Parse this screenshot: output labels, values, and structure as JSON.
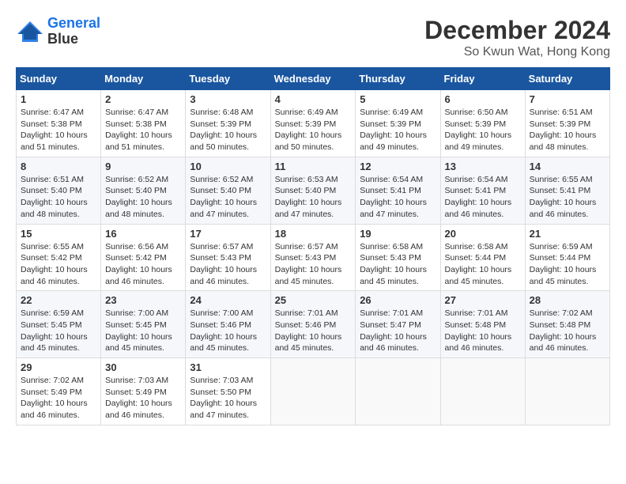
{
  "header": {
    "logo_line1": "General",
    "logo_line2": "Blue",
    "month": "December 2024",
    "location": "So Kwun Wat, Hong Kong"
  },
  "weekdays": [
    "Sunday",
    "Monday",
    "Tuesday",
    "Wednesday",
    "Thursday",
    "Friday",
    "Saturday"
  ],
  "weeks": [
    [
      {
        "day": "1",
        "sunrise": "6:47 AM",
        "sunset": "5:38 PM",
        "daylight": "10 hours and 51 minutes."
      },
      {
        "day": "2",
        "sunrise": "6:47 AM",
        "sunset": "5:38 PM",
        "daylight": "10 hours and 51 minutes."
      },
      {
        "day": "3",
        "sunrise": "6:48 AM",
        "sunset": "5:39 PM",
        "daylight": "10 hours and 50 minutes."
      },
      {
        "day": "4",
        "sunrise": "6:49 AM",
        "sunset": "5:39 PM",
        "daylight": "10 hours and 50 minutes."
      },
      {
        "day": "5",
        "sunrise": "6:49 AM",
        "sunset": "5:39 PM",
        "daylight": "10 hours and 49 minutes."
      },
      {
        "day": "6",
        "sunrise": "6:50 AM",
        "sunset": "5:39 PM",
        "daylight": "10 hours and 49 minutes."
      },
      {
        "day": "7",
        "sunrise": "6:51 AM",
        "sunset": "5:39 PM",
        "daylight": "10 hours and 48 minutes."
      }
    ],
    [
      {
        "day": "8",
        "sunrise": "6:51 AM",
        "sunset": "5:40 PM",
        "daylight": "10 hours and 48 minutes."
      },
      {
        "day": "9",
        "sunrise": "6:52 AM",
        "sunset": "5:40 PM",
        "daylight": "10 hours and 48 minutes."
      },
      {
        "day": "10",
        "sunrise": "6:52 AM",
        "sunset": "5:40 PM",
        "daylight": "10 hours and 47 minutes."
      },
      {
        "day": "11",
        "sunrise": "6:53 AM",
        "sunset": "5:40 PM",
        "daylight": "10 hours and 47 minutes."
      },
      {
        "day": "12",
        "sunrise": "6:54 AM",
        "sunset": "5:41 PM",
        "daylight": "10 hours and 47 minutes."
      },
      {
        "day": "13",
        "sunrise": "6:54 AM",
        "sunset": "5:41 PM",
        "daylight": "10 hours and 46 minutes."
      },
      {
        "day": "14",
        "sunrise": "6:55 AM",
        "sunset": "5:41 PM",
        "daylight": "10 hours and 46 minutes."
      }
    ],
    [
      {
        "day": "15",
        "sunrise": "6:55 AM",
        "sunset": "5:42 PM",
        "daylight": "10 hours and 46 minutes."
      },
      {
        "day": "16",
        "sunrise": "6:56 AM",
        "sunset": "5:42 PM",
        "daylight": "10 hours and 46 minutes."
      },
      {
        "day": "17",
        "sunrise": "6:57 AM",
        "sunset": "5:43 PM",
        "daylight": "10 hours and 46 minutes."
      },
      {
        "day": "18",
        "sunrise": "6:57 AM",
        "sunset": "5:43 PM",
        "daylight": "10 hours and 45 minutes."
      },
      {
        "day": "19",
        "sunrise": "6:58 AM",
        "sunset": "5:43 PM",
        "daylight": "10 hours and 45 minutes."
      },
      {
        "day": "20",
        "sunrise": "6:58 AM",
        "sunset": "5:44 PM",
        "daylight": "10 hours and 45 minutes."
      },
      {
        "day": "21",
        "sunrise": "6:59 AM",
        "sunset": "5:44 PM",
        "daylight": "10 hours and 45 minutes."
      }
    ],
    [
      {
        "day": "22",
        "sunrise": "6:59 AM",
        "sunset": "5:45 PM",
        "daylight": "10 hours and 45 minutes."
      },
      {
        "day": "23",
        "sunrise": "7:00 AM",
        "sunset": "5:45 PM",
        "daylight": "10 hours and 45 minutes."
      },
      {
        "day": "24",
        "sunrise": "7:00 AM",
        "sunset": "5:46 PM",
        "daylight": "10 hours and 45 minutes."
      },
      {
        "day": "25",
        "sunrise": "7:01 AM",
        "sunset": "5:46 PM",
        "daylight": "10 hours and 45 minutes."
      },
      {
        "day": "26",
        "sunrise": "7:01 AM",
        "sunset": "5:47 PM",
        "daylight": "10 hours and 46 minutes."
      },
      {
        "day": "27",
        "sunrise": "7:01 AM",
        "sunset": "5:48 PM",
        "daylight": "10 hours and 46 minutes."
      },
      {
        "day": "28",
        "sunrise": "7:02 AM",
        "sunset": "5:48 PM",
        "daylight": "10 hours and 46 minutes."
      }
    ],
    [
      {
        "day": "29",
        "sunrise": "7:02 AM",
        "sunset": "5:49 PM",
        "daylight": "10 hours and 46 minutes."
      },
      {
        "day": "30",
        "sunrise": "7:03 AM",
        "sunset": "5:49 PM",
        "daylight": "10 hours and 46 minutes."
      },
      {
        "day": "31",
        "sunrise": "7:03 AM",
        "sunset": "5:50 PM",
        "daylight": "10 hours and 47 minutes."
      },
      null,
      null,
      null,
      null
    ]
  ]
}
